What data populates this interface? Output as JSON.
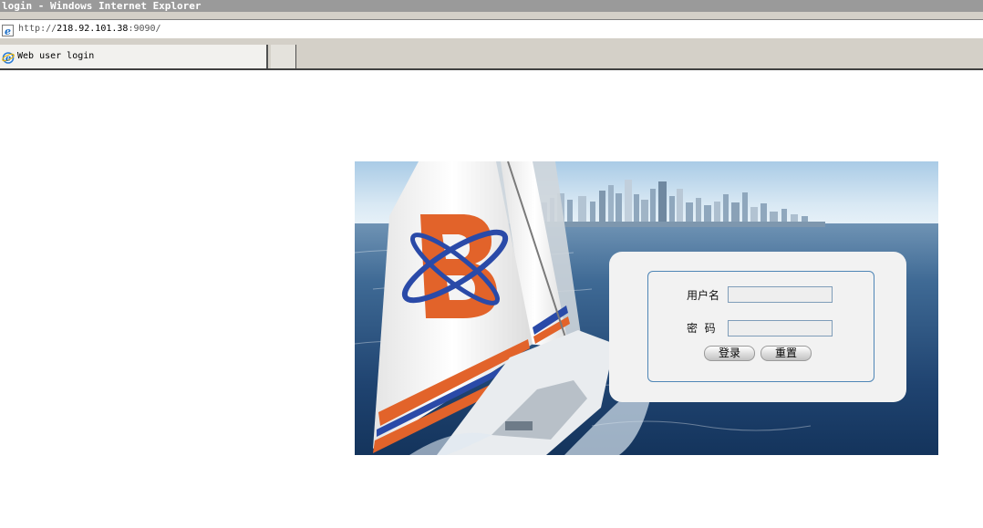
{
  "window": {
    "title": "login - Windows Internet Explorer"
  },
  "address_bar": {
    "protocol": "http://",
    "host": "218.92.101.38",
    "port": ":9090/"
  },
  "tabs": [
    {
      "label": "Web user login",
      "icon": "ie-icon"
    }
  ],
  "login": {
    "username_label": "用户名",
    "password_label": "密  码",
    "username_value": "",
    "password_value": "",
    "login_button": "登录",
    "reset_button": "重置"
  },
  "colors": {
    "titlebar": "#9a9a9a",
    "chrome": "#d4d0c8",
    "panel_border": "#4f86b6",
    "logo_orange": "#e2632a",
    "logo_blue": "#2a4aa8"
  }
}
